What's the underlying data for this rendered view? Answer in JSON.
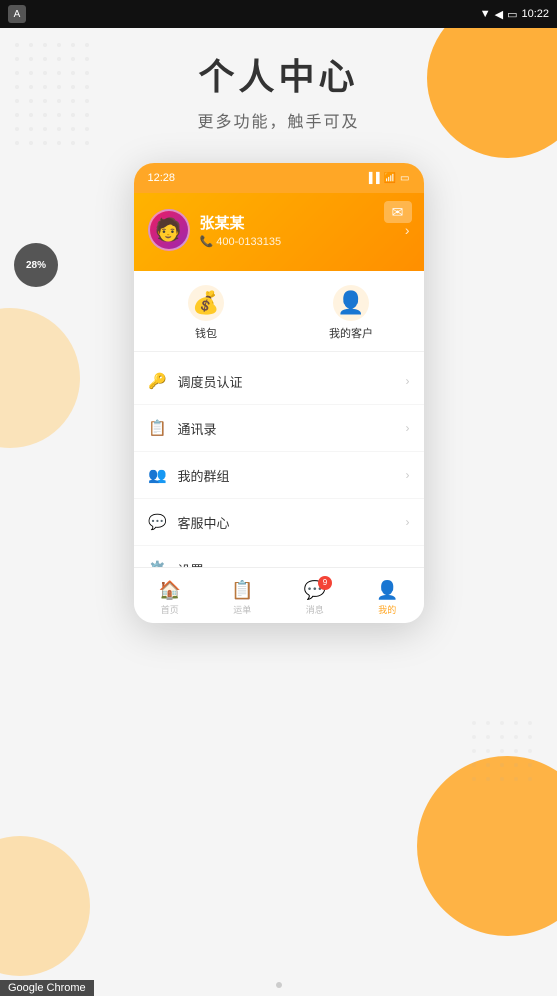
{
  "statusBar": {
    "time": "10:22",
    "appIcon": "A"
  },
  "background": {
    "title": "个人中心",
    "subtitle": "更多功能，触手可及"
  },
  "phone": {
    "statusBar": {
      "time": "12:28"
    },
    "profile": {
      "name": "张某某",
      "phone": "400-0133135"
    },
    "quickIcons": [
      {
        "id": "wallet",
        "icon": "💰",
        "label": "钱包"
      },
      {
        "id": "my-customers",
        "icon": "👤",
        "label": "我的客户"
      }
    ],
    "menuItems": [
      {
        "id": "dispatcher-auth",
        "icon": "🔑",
        "label": "调度员认证"
      },
      {
        "id": "contacts",
        "icon": "📋",
        "label": "通讯录"
      },
      {
        "id": "my-group",
        "icon": "👥",
        "label": "我的群组"
      },
      {
        "id": "customer-service",
        "icon": "💬",
        "label": "客服中心"
      },
      {
        "id": "settings",
        "icon": "⚙️",
        "label": "设置"
      }
    ],
    "tabBar": [
      {
        "id": "home",
        "icon": "🏠",
        "label": "首页",
        "active": false,
        "badge": null
      },
      {
        "id": "order",
        "icon": "📋",
        "label": "运单",
        "active": false,
        "badge": null
      },
      {
        "id": "message",
        "icon": "💬",
        "label": "消息",
        "active": false,
        "badge": "9"
      },
      {
        "id": "mine",
        "icon": "👤",
        "label": "我的",
        "active": true,
        "badge": null
      }
    ]
  },
  "chromeBar": {
    "label": "Google Chrome"
  },
  "progressBadge": "28%"
}
